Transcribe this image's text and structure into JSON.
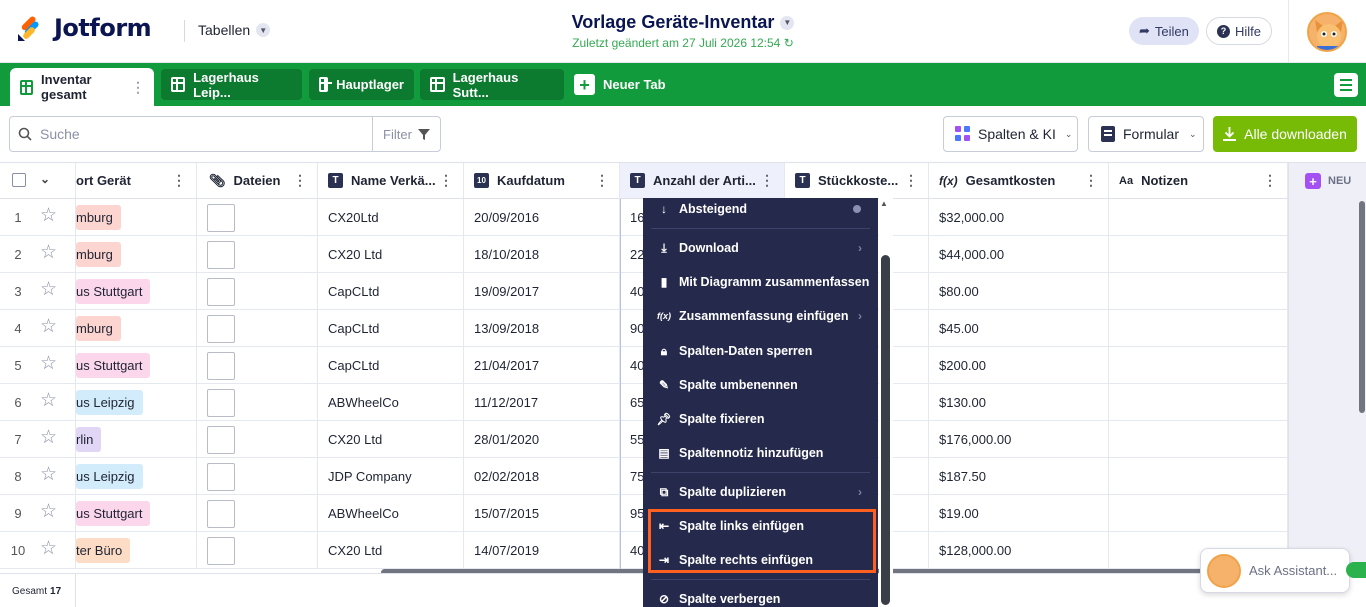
{
  "header": {
    "logo_text": "Jotform",
    "tables_label": "Tabellen",
    "title": "Vorlage Geräte-Inventar",
    "subtitle": "Zuletzt geändert am 27 Juli 2026 12:54",
    "share_label": "Teilen",
    "help_label": "Hilfe"
  },
  "tabs": [
    {
      "label": "Inventar gesamt"
    },
    {
      "label": "Lagerhaus Leip..."
    },
    {
      "label": "Hauptlager"
    },
    {
      "label": "Lagerhaus Sutt..."
    }
  ],
  "new_tab_label": "Neuer Tab",
  "toolbar": {
    "search_placeholder": "Suche",
    "filter_label": "Filter",
    "columns_ai_label": "Spalten & KI",
    "form_label": "Formular",
    "download_all_label": "Alle downloaden"
  },
  "columns": [
    {
      "label": "ort Gerät"
    },
    {
      "label": "Dateien"
    },
    {
      "label": "Name Verkä..."
    },
    {
      "label": "Kaufdatum"
    },
    {
      "label": "Anzahl der Arti..."
    },
    {
      "label": "Stückkoste..."
    },
    {
      "label": "Gesamtkosten"
    },
    {
      "label": "Notizen"
    }
  ],
  "new_column_label": "NEU",
  "rows": [
    {
      "num": "1",
      "location": "mburg",
      "location_color": "#fcd5d0",
      "vendor": "CX20Ltd",
      "date": "20/09/2016",
      "qty": "16",
      "total": "$32,000.00"
    },
    {
      "num": "2",
      "location": "mburg",
      "location_color": "#fcd5d0",
      "vendor": "CX20 Ltd",
      "date": "18/10/2018",
      "qty": "22",
      "total": "$44,000.00"
    },
    {
      "num": "3",
      "location": "us Stuttgart",
      "location_color": "#fcd7ec",
      "vendor": "CapCLtd",
      "date": "19/09/2017",
      "qty": "40",
      "total": "$80.00"
    },
    {
      "num": "4",
      "location": "mburg",
      "location_color": "#fcd5d0",
      "vendor": "CapCLtd",
      "date": "13/09/2018",
      "qty": "90",
      "total": "$45.00"
    },
    {
      "num": "5",
      "location": "us Stuttgart",
      "location_color": "#fcd7ec",
      "vendor": "CapCLtd",
      "date": "21/04/2017",
      "qty": "40",
      "total": "$200.00"
    },
    {
      "num": "6",
      "location": "us Leipzig",
      "location_color": "#d3ecfb",
      "vendor": "ABWheelCo",
      "date": "11/12/2017",
      "qty": "65",
      "total": "$130.00"
    },
    {
      "num": "7",
      "location": "rlin",
      "location_color": "#e2d6f6",
      "vendor": "CX20 Ltd",
      "date": "28/01/2020",
      "qty": "55",
      "total": "$176,000.00"
    },
    {
      "num": "8",
      "location": "us Leipzig",
      "location_color": "#d3ecfb",
      "vendor": "JDP Company",
      "date": "02/02/2018",
      "qty": "75",
      "total": "$187.50"
    },
    {
      "num": "9",
      "location": "us Stuttgart",
      "location_color": "#fcd7ec",
      "vendor": "ABWheelCo",
      "date": "15/07/2015",
      "qty": "95",
      "total": "$19.00"
    },
    {
      "num": "10",
      "location": "ter Büro",
      "location_color": "#fcdcc4",
      "vendor": "CX20 Ltd",
      "date": "14/07/2019",
      "qty": "40",
      "total": "$128,000.00"
    }
  ],
  "footer": {
    "total_label": "Gesamt",
    "total_count": "17"
  },
  "context_menu": [
    {
      "label": "Absteigend",
      "icon": "sort-desc-icon"
    },
    {
      "label": "Download",
      "icon": "download-icon"
    },
    {
      "label": "Mit Diagramm zusammenfassen",
      "icon": "chart-icon"
    },
    {
      "label": "Zusammenfassung einfügen",
      "icon": "function-icon"
    },
    {
      "label": "Spalten-Daten sperren",
      "icon": "lock-icon"
    },
    {
      "label": "Spalte umbenennen",
      "icon": "pencil-icon"
    },
    {
      "label": "Spalte fixieren",
      "icon": "pin-icon"
    },
    {
      "label": "Spaltennotiz hinzufügen",
      "icon": "note-icon"
    },
    {
      "label": "Spalte duplizieren",
      "icon": "duplicate-icon"
    },
    {
      "label": "Spalte links einfügen",
      "icon": "insert-left-icon"
    },
    {
      "label": "Spalte rechts einfügen",
      "icon": "insert-right-icon"
    },
    {
      "label": "Spalte verbergen",
      "icon": "hide-icon"
    }
  ],
  "assistant_label": "Ask Assistant...",
  "colors": {
    "brand_green": "#129b3d",
    "download_green": "#78bb07",
    "menu_bg": "#252a4c",
    "highlight": "#ff5f1f"
  }
}
